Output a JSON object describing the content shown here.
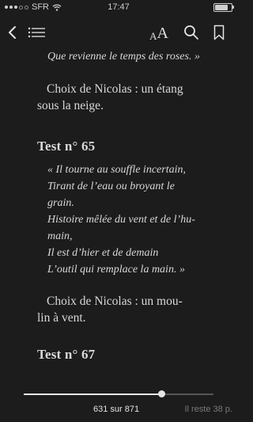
{
  "status": {
    "carrier": "SFR",
    "time": "17:47",
    "battery_level": 0.8
  },
  "toolbar": {
    "back_icon": "chevron-left-icon",
    "toc_icon": "list-icon",
    "font_small": "A",
    "font_big": "A",
    "search_icon": "search-icon",
    "bookmark_icon": "bookmark-icon"
  },
  "book": {
    "quote_end": "Que revienne le temps des roses. »",
    "para1": [
      "Choix de Nicolas : un étang",
      "sous la neige."
    ],
    "heading1": "Test n° 65",
    "poem": [
      "« Il tourne au souffle incertain,",
      "Tirant de l’eau ou broyant le",
      "grain.",
      "Histoire mêlée du vent et de l’hu-",
      "main,",
      "Il est d’hier et de demain",
      "L’outil qui remplace la main. »"
    ],
    "para2": [
      "Choix de Nicolas : un mou-",
      "lin à vent."
    ],
    "heading2": "Test n° 67"
  },
  "progress": {
    "fraction": 0.724,
    "page_label": "631 sur 871",
    "remaining_label": "Il reste 38 p."
  }
}
